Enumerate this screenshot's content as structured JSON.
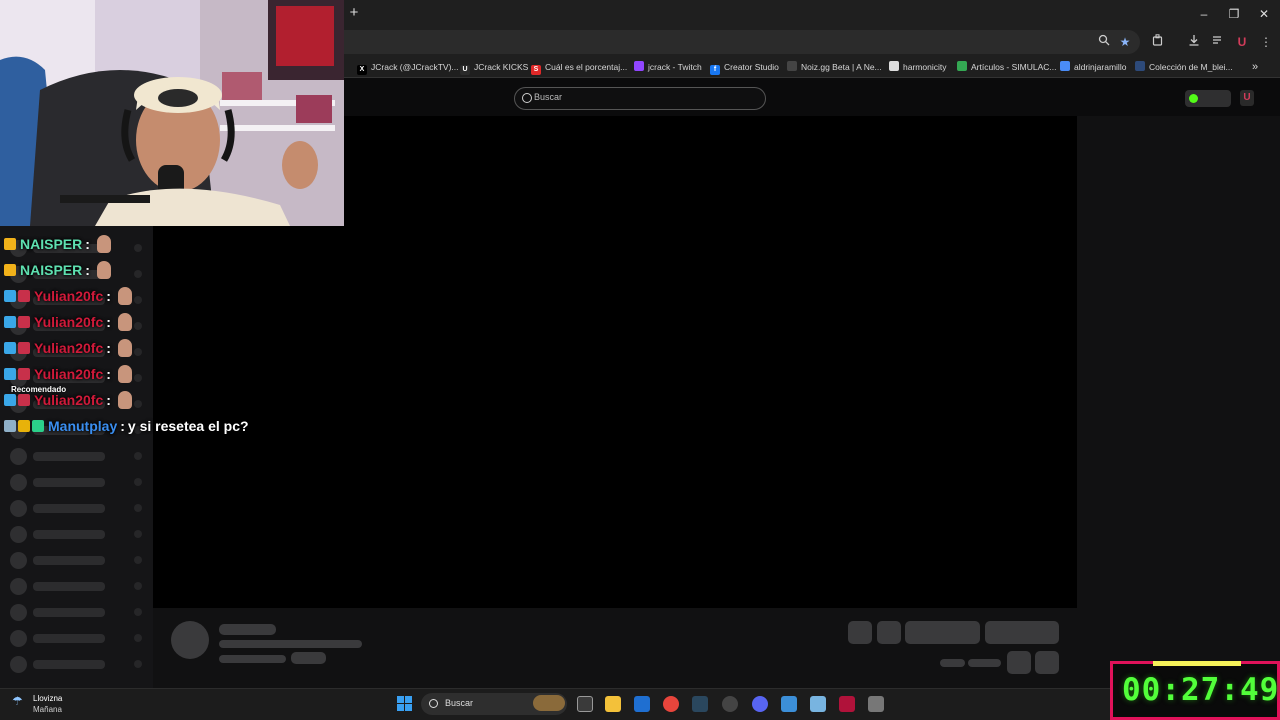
{
  "browser": {
    "new_tab": "+",
    "window_controls": [
      "–",
      "❐",
      "✕"
    ],
    "bookmarks": [
      {
        "label": "JCrack (@JCrackTV)...",
        "icon": "x-icon",
        "color": "#000000",
        "glyph": "X"
      },
      {
        "label": "JCrack KICKS",
        "icon": "kick-icon",
        "color": "#2a2a2a",
        "glyph": "U"
      },
      {
        "label": "Cuál es el porcentaj...",
        "icon": "s-icon",
        "color": "#e02828",
        "glyph": "S"
      },
      {
        "label": "jcrack - Twitch",
        "icon": "twitch-icon",
        "color": "#9146ff",
        "glyph": ""
      },
      {
        "label": "Creator Studio",
        "icon": "facebook-icon",
        "color": "#1877f2",
        "glyph": "f"
      },
      {
        "label": "Noiz.gg Beta | A Ne...",
        "icon": "noiz-icon",
        "color": "#444444",
        "glyph": ""
      },
      {
        "label": "harmonicity",
        "icon": "page-icon",
        "color": "#dddddd",
        "glyph": ""
      },
      {
        "label": "Artículos - SIMULAC...",
        "icon": "drive-icon",
        "color": "#34a853",
        "glyph": ""
      },
      {
        "label": "aldrinjaramillo",
        "icon": "calendar-icon",
        "color": "#4a8cf7",
        "glyph": ""
      },
      {
        "label": "Colección de M_blei...",
        "icon": "globe-icon",
        "color": "#2d4a7a",
        "glyph": ""
      }
    ],
    "more_bookmarks": "»"
  },
  "kick": {
    "search_placeholder": "Buscar",
    "accent": "#53fc18"
  },
  "chat": {
    "recommended_label": "Recomendado",
    "messages": [
      {
        "user": "NAISPER",
        "user_color": "#5ee0b0",
        "badge": "crown",
        "text": ""
      },
      {
        "user": "NAISPER",
        "user_color": "#5ee0b0",
        "badge": "crown",
        "text": ""
      },
      {
        "user": "Yulian20fc",
        "user_color": "#d01a3a",
        "badge": "cube",
        "text": ""
      },
      {
        "user": "Yulian20fc",
        "user_color": "#d01a3a",
        "badge": "cube",
        "text": ""
      },
      {
        "user": "Yulian20fc",
        "user_color": "#d01a3a",
        "badge": "cube",
        "text": ""
      },
      {
        "user": "Yulian20fc",
        "user_color": "#d01a3a",
        "badge": "cube",
        "text": ""
      },
      {
        "user": "Yulian20fc",
        "user_color": "#d01a3a",
        "badge": "cube",
        "text": ""
      },
      {
        "user": "Manutplay",
        "user_color": "#3a8ef0",
        "badge": "multi",
        "text": "y si resetea el pc?"
      }
    ]
  },
  "taskbar": {
    "weather_line1": "Llovizna",
    "weather_line2": "Mañana",
    "search_placeholder": "Buscar"
  },
  "timer": {
    "value": "00:27:49"
  }
}
